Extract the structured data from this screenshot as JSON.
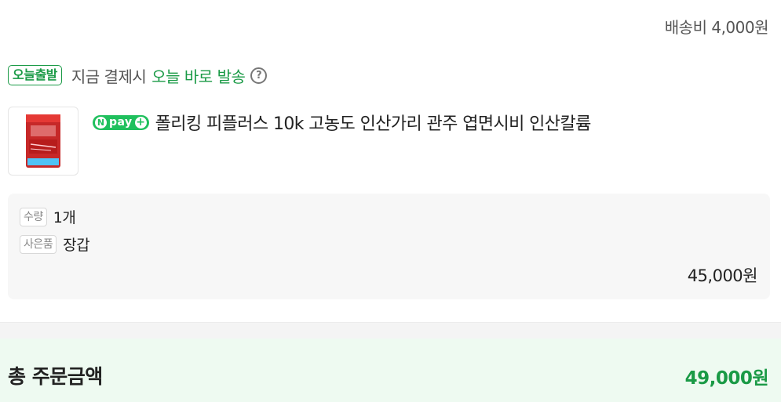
{
  "shipping": {
    "fee_text": "배송비 4,000원"
  },
  "dispatch": {
    "badge": "오늘출발",
    "text": "지금 결제시",
    "highlight": "오늘 바로 발송",
    "help_icon": "?"
  },
  "product": {
    "npay": {
      "n": "N",
      "pay": "pay",
      "plus": "+"
    },
    "title": "폴리킹 피플러스 10k 고농도 인산가리 관주 엽면시비 인산칼륨"
  },
  "options": {
    "quantity_label": "수량",
    "quantity_value": "1개",
    "gift_label": "사은품",
    "gift_value": "장갑",
    "price": "45,000원"
  },
  "total": {
    "label": "총 주문금액",
    "value": "49,000원"
  },
  "colors": {
    "accent_green": "#1a9a46",
    "npay_green": "#1fc05d",
    "total_bg": "#eefaf1"
  },
  "icons": [
    "help-icon",
    "npay-plus-icon",
    "product-thumbnail"
  ]
}
